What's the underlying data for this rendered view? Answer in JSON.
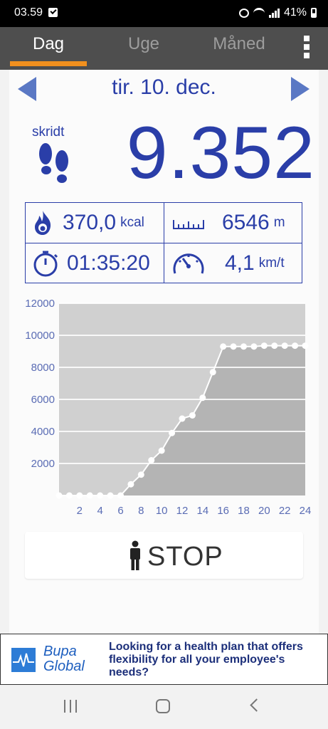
{
  "status_bar": {
    "time": "03.59",
    "battery": "41%"
  },
  "tabs": [
    {
      "label": "Dag",
      "active": true
    },
    {
      "label": "Uge",
      "active": false
    },
    {
      "label": "Måned",
      "active": false
    }
  ],
  "date_nav": {
    "date": "tir. 10. dec.",
    "prev_icon": "arrow-left-icon",
    "next_icon": "arrow-right-icon"
  },
  "steps": {
    "label": "skridt",
    "value": "9.352",
    "icon": "footprints-icon"
  },
  "stats": {
    "calories": {
      "value": "370,0",
      "unit": "kcal",
      "icon": "flame-icon"
    },
    "distance": {
      "value": "6546",
      "unit": "m",
      "icon": "ruler-icon"
    },
    "duration": {
      "value": "01:35:20",
      "icon": "stopwatch-icon"
    },
    "speed": {
      "value": "4,1",
      "unit": "km/t",
      "icon": "speedometer-icon"
    }
  },
  "chart_data": {
    "type": "area",
    "x": [
      0,
      1,
      2,
      3,
      4,
      5,
      6,
      7,
      8,
      9,
      10,
      11,
      12,
      13,
      14,
      15,
      16,
      17,
      18,
      19,
      20,
      21,
      22,
      23,
      24
    ],
    "values": [
      0,
      0,
      0,
      0,
      0,
      0,
      0,
      700,
      1300,
      2200,
      2800,
      3900,
      4800,
      5000,
      6100,
      7700,
      9300,
      9300,
      9300,
      9300,
      9352,
      9352,
      9352,
      9352,
      9352
    ],
    "x_ticks": [
      "2",
      "4",
      "6",
      "8",
      "10",
      "12",
      "14",
      "16",
      "18",
      "20",
      "22",
      "24"
    ],
    "y_ticks": [
      "2000",
      "4000",
      "6000",
      "8000",
      "10000",
      "12000"
    ],
    "xlim": [
      0,
      24
    ],
    "ylim": [
      0,
      12000
    ],
    "title": "",
    "xlabel": "",
    "ylabel": "",
    "grid": true,
    "colors": {
      "area": "#b4b4b4",
      "plot_bg": "#d0d0d0",
      "line": "#ffffff",
      "tick": "#5a6cb4"
    }
  },
  "stop_button": {
    "label": "STOP",
    "icon": "person-icon"
  },
  "ad": {
    "brand_line1": "Bupa",
    "brand_line2": "Global",
    "text": "Looking for a health plan that offers flexibility for all your employee's needs?"
  },
  "nav_bar": {
    "recents_icon": "recents-icon",
    "home_icon": "home-icon",
    "back_icon": "back-icon"
  },
  "colors": {
    "accent": "#2a3ea8",
    "tab_bar": "#4e4e4e",
    "tab_indicator": "#f1901e"
  }
}
